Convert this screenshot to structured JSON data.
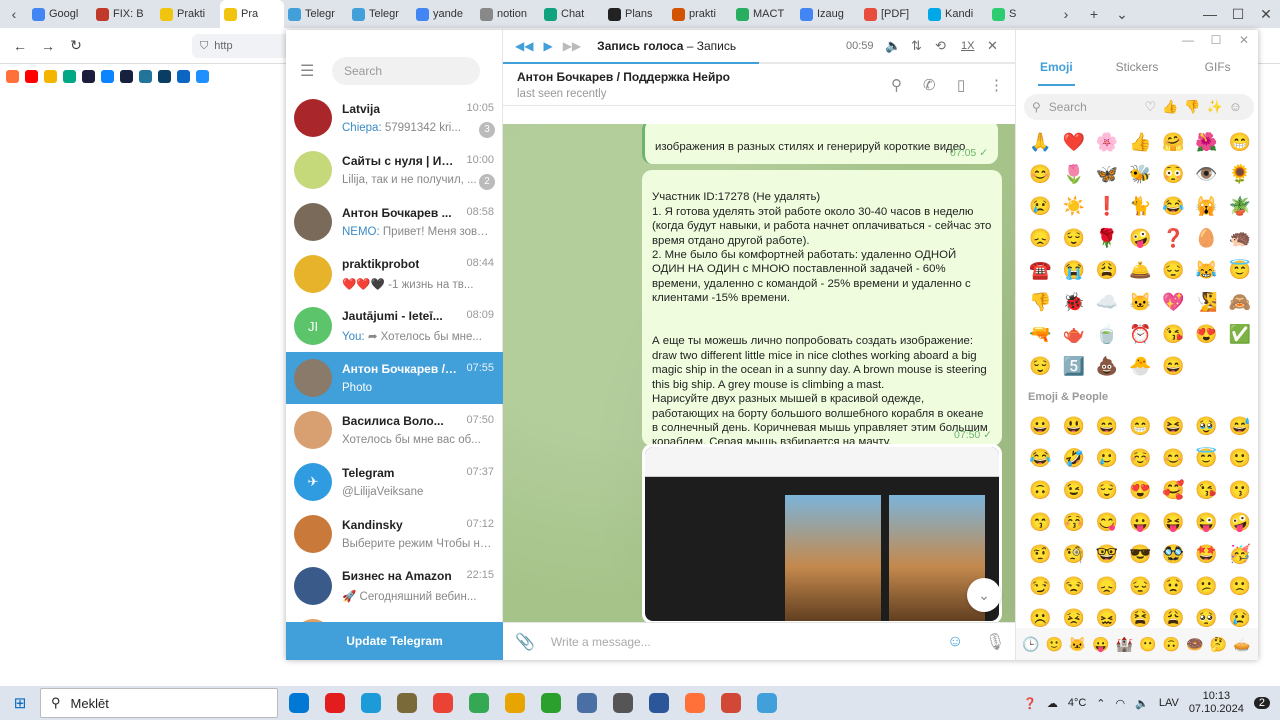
{
  "browser": {
    "tabs": [
      {
        "label": "Googl",
        "color": "#4285f4"
      },
      {
        "label": "FIX: B",
        "color": "#c0392b"
      },
      {
        "label": "Prakti",
        "color": "#f1c40f"
      },
      {
        "label": "Pra",
        "color": "#f1c40f",
        "active": true
      },
      {
        "label": "Telegr",
        "color": "#419fd9"
      },
      {
        "label": "Telegr",
        "color": "#419fd9"
      },
      {
        "label": "yande",
        "color": "#4285f4"
      },
      {
        "label": "notion",
        "color": "#888888"
      },
      {
        "label": "Chat",
        "color": "#10a37f"
      },
      {
        "label": "Plans",
        "color": "#222222"
      },
      {
        "label": "prakti",
        "color": "#d35400"
      },
      {
        "label": "MACT",
        "color": "#27ae60"
      },
      {
        "label": "Izaug",
        "color": "#4285f4"
      },
      {
        "label": "[PDF]",
        "color": "#e74c3c"
      },
      {
        "label": "Kandi",
        "color": "#00a8e8"
      },
      {
        "label": "S",
        "color": "#2ecc71"
      }
    ],
    "url_partial": "http"
  },
  "telegram": {
    "search_placeholder": "Search",
    "chats": [
      {
        "name": "Latvija",
        "time": "10:05",
        "sender": "Chiepa:",
        "preview": "57991342 kri...",
        "badge": "3",
        "avatar_color": "#a9262b"
      },
      {
        "name": "Сайты с нуля | Ин...",
        "time": "10:00",
        "sender": "",
        "preview": "Lilija, так и не получил, ...",
        "badge": "2",
        "avatar_color": "#c5d87a"
      },
      {
        "name": "Антон Бочкарев ...",
        "time": "08:58",
        "sender": "NEMO:",
        "preview": "Привет!  Меня зовут ...",
        "badge": "",
        "avatar_color": "#7a6a5a"
      },
      {
        "name": "praktikprobot",
        "time": "08:44",
        "sender": "",
        "preview": "❤️❤️🖤 -1 жизнь на тв...",
        "badge": "",
        "avatar_color": "#e6b32a"
      },
      {
        "name": "Jautājumi - Ieteī...",
        "time": "08:09",
        "sender": "You:",
        "preview": "➦ Хотелось бы мне...",
        "badge": "",
        "avatar_color": "#5cc46b",
        "avatar_text": "JI"
      },
      {
        "name": "Антон Бочкарев / ...",
        "time": "07:55",
        "sender": "",
        "preview": "Photo",
        "badge": "",
        "avatar_color": "#8a7a6a",
        "selected": true
      },
      {
        "name": "Василиса Воло...",
        "time": "07:50",
        "sender": "",
        "preview": "Хотелось бы мне вас об...",
        "badge": "",
        "avatar_color": "#d8a070"
      },
      {
        "name": "Telegram",
        "time": "07:37",
        "sender": "",
        "preview": "@LilijaVeiksane",
        "badge": "",
        "avatar_color": "#2f9be0",
        "avatar_text": "✈"
      },
      {
        "name": "Kandinsky",
        "time": "07:12",
        "sender": "",
        "preview": "Выберите режим  Чтобы на...",
        "badge": "",
        "avatar_color": "#c97a3a"
      },
      {
        "name": "Бизнес на Amazon",
        "time": "22:15",
        "sender": "",
        "preview": "🚀 Сегодняшний вебин...",
        "badge": "",
        "avatar_color": "#3a5a8a"
      },
      {
        "name": "End Off Shift I...",
        "time": "19:44",
        "sender": "",
        "preview": "",
        "badge": "",
        "avatar_color": "#e0a060"
      }
    ],
    "update_label": "Update Telegram",
    "player": {
      "title_bold": "Запись голоса",
      "title_rest": " – Запись",
      "time": "00:59",
      "speed": "1X",
      "progress": 0.5
    },
    "chat": {
      "title": "Антон Бочкарев / Поддержка Нейро",
      "status": "last seen recently"
    },
    "messages": [
      {
        "text": "изображения в разных стилях и генерируй короткие видео",
        "time": "07:05"
      },
      {
        "text": "Участник ID:17278 (Не удалять)\n1. Я готова уделять этой работе около 30-40 часов в неделю (когда будут навыки, и работа начнет оплачиваться - сейчас это время отдано другой работе).\n2. Мне было бы комфортней работать: удаленно ОДНОЙ ОДИН НА ОДИН с МНОЮ поставленной задачей - 60% времени, удаленно с командой - 25% времени и удаленно с клиентами -15% времени.\n\n\nА еще ты можешь лично попробовать создать изображение:\ndraw two different little mice in nice clothes working aboard a big magic ship in the ocean in a sunny day. A brown mouse is steering this big ship. A grey mouse is climbing a mast.\nНарисуйте двух разных мышей в красивой одежде, работающих на борту большого волшебного корабля в океане в солнечный день. Коричневая мышь управляет этим большим кораблем. Серая мышь взбирается на мачту.",
        "time": "07:50"
      }
    ],
    "composer_placeholder": "Write a message...",
    "emoji_panel": {
      "tabs": [
        "Emoji",
        "Stickers",
        "GIFs"
      ],
      "search_placeholder": "Search",
      "recent": [
        "🙏",
        "❤️",
        "🌸",
        "👍",
        "🤗",
        "🌺",
        "😁",
        "😊",
        "🌷",
        "🦋",
        "🐝",
        "😳",
        "👁️",
        "🌻",
        "😢",
        "☀️",
        "❗",
        "🐈",
        "😂",
        "🙀",
        "🪴",
        "😞",
        "😌",
        "🌹",
        "🤪",
        "❓",
        "🥚",
        "🦔",
        "☎️",
        "😭",
        "😩",
        "🛎️",
        "😔",
        "😹",
        "😇",
        "👎",
        "🐞",
        "☁️",
        "🐱",
        "💖",
        "🧏",
        "🙈",
        "🔫",
        "🫖",
        "🍵",
        "⏰",
        "😘",
        "😍",
        "✅",
        "😌",
        "5️⃣",
        "💩",
        "🐣",
        "😄"
      ],
      "section_title": "Emoji & People",
      "people": [
        "😀",
        "😃",
        "😄",
        "😁",
        "😆",
        "🥹",
        "😅",
        "😂",
        "🤣",
        "🥲",
        "☺️",
        "😊",
        "😇",
        "🙂",
        "🙃",
        "😉",
        "😌",
        "😍",
        "🥰",
        "😘",
        "😗",
        "😙",
        "😚",
        "😋",
        "😛",
        "😝",
        "😜",
        "🤪",
        "🤨",
        "🧐",
        "🤓",
        "😎",
        "🥸",
        "🤩",
        "🥳",
        "😏",
        "😒",
        "😞",
        "😔",
        "😟",
        "😕",
        "🙁",
        "☹️",
        "😣",
        "😖",
        "😫",
        "😩",
        "🥺",
        "😢"
      ],
      "categories": [
        "🕒",
        "🙂",
        "🐱",
        "😛",
        "🏰",
        "😶",
        "🙃",
        "🍩",
        "🤔",
        "🥧"
      ]
    },
    "titlebar": [
      "—",
      "☐",
      "✕"
    ]
  },
  "taskbar": {
    "search_placeholder": "Meklēt",
    "apps": [
      "#0078d4",
      "#e31d1d",
      "#1c9bd8",
      "#7a6a3a",
      "#ea4335",
      "#34a853",
      "#e8a400",
      "#2ca02c",
      "#4a6fa5",
      "#555555",
      "#2b579a",
      "#ff7139",
      "#d14836",
      "#419fd9"
    ],
    "weather": "4°C",
    "lang": "LAV",
    "time": "10:13",
    "date": "07.10.2024",
    "notif_count": "2"
  }
}
